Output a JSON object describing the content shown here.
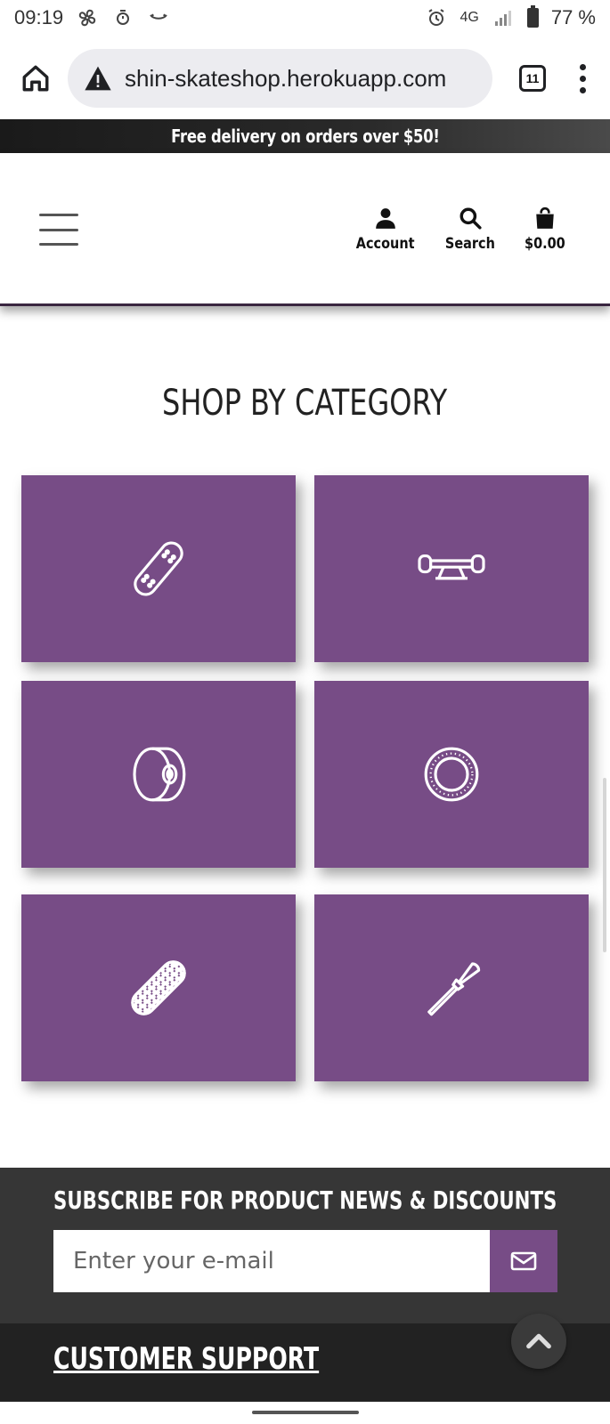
{
  "status_bar": {
    "time": "09:19",
    "network": "4G",
    "battery": "77 %"
  },
  "browser": {
    "url": "shin-skateshop.herokuapp.com",
    "tab_count": "11"
  },
  "banner": {
    "text": "Free delivery on orders over $50!"
  },
  "header": {
    "account_label": "Account",
    "search_label": "Search",
    "cart_label": "$0.00"
  },
  "main": {
    "section_title": "SHOP BY CATEGORY",
    "categories": [
      {
        "icon": "skateboard-deck-icon"
      },
      {
        "icon": "truck-icon"
      },
      {
        "icon": "wheel-icon"
      },
      {
        "icon": "bearing-icon"
      },
      {
        "icon": "griptape-icon"
      },
      {
        "icon": "screwdriver-icon"
      }
    ],
    "accent_color": "#774c86"
  },
  "subscribe": {
    "title": "SUBSCRIBE FOR PRODUCT NEWS & DISCOUNTS",
    "placeholder": "Enter your e-mail"
  },
  "footer": {
    "support_title": "CUSTOMER SUPPORT"
  }
}
